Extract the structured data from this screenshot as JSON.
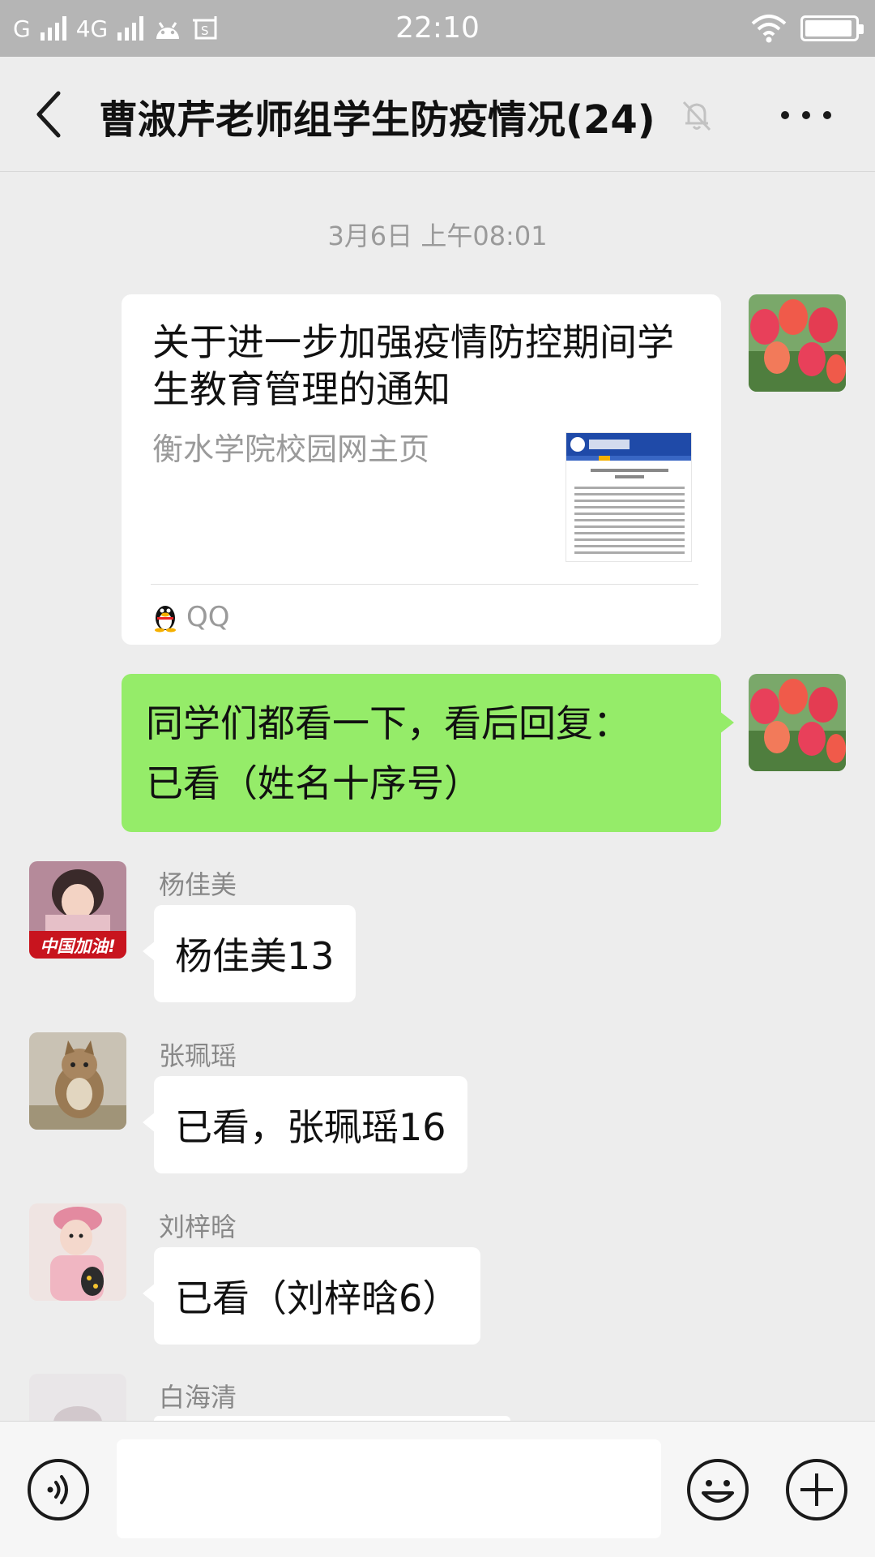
{
  "status_bar": {
    "carrier1": "G",
    "carrier2": "4G",
    "time": "22:10"
  },
  "header": {
    "title": "曹淑芹老师组学生防疫情况(24)"
  },
  "chat": {
    "timestamp": "3月6日 上午08:01",
    "card": {
      "title": "关于进一步加强疫情防控期间学生教育管理的通知",
      "source": "衡水学院校园网主页",
      "app": "QQ"
    },
    "outgoing_text_line1": "同学们都看一下，看后回复：",
    "outgoing_text_line2": "已看（姓名十序号）",
    "messages": [
      {
        "sender": "杨佳美",
        "text": "杨佳美13",
        "avatar_badge": "中国加油!"
      },
      {
        "sender": "张珮瑶",
        "text": "已看，张珮瑶16"
      },
      {
        "sender": "刘梓晗",
        "text": "已看（刘梓晗6）"
      },
      {
        "sender": "白海清",
        "text": ""
      }
    ]
  },
  "input": {
    "placeholder": ""
  },
  "icons": {
    "back": "chevron-left-icon",
    "mute": "bell-off-icon",
    "more": "more-dots-icon",
    "voice": "voice-icon",
    "emoji": "emoji-icon",
    "plus": "plus-icon"
  },
  "colors": {
    "outgoing_bubble": "#95ec69",
    "background": "#ededed"
  }
}
